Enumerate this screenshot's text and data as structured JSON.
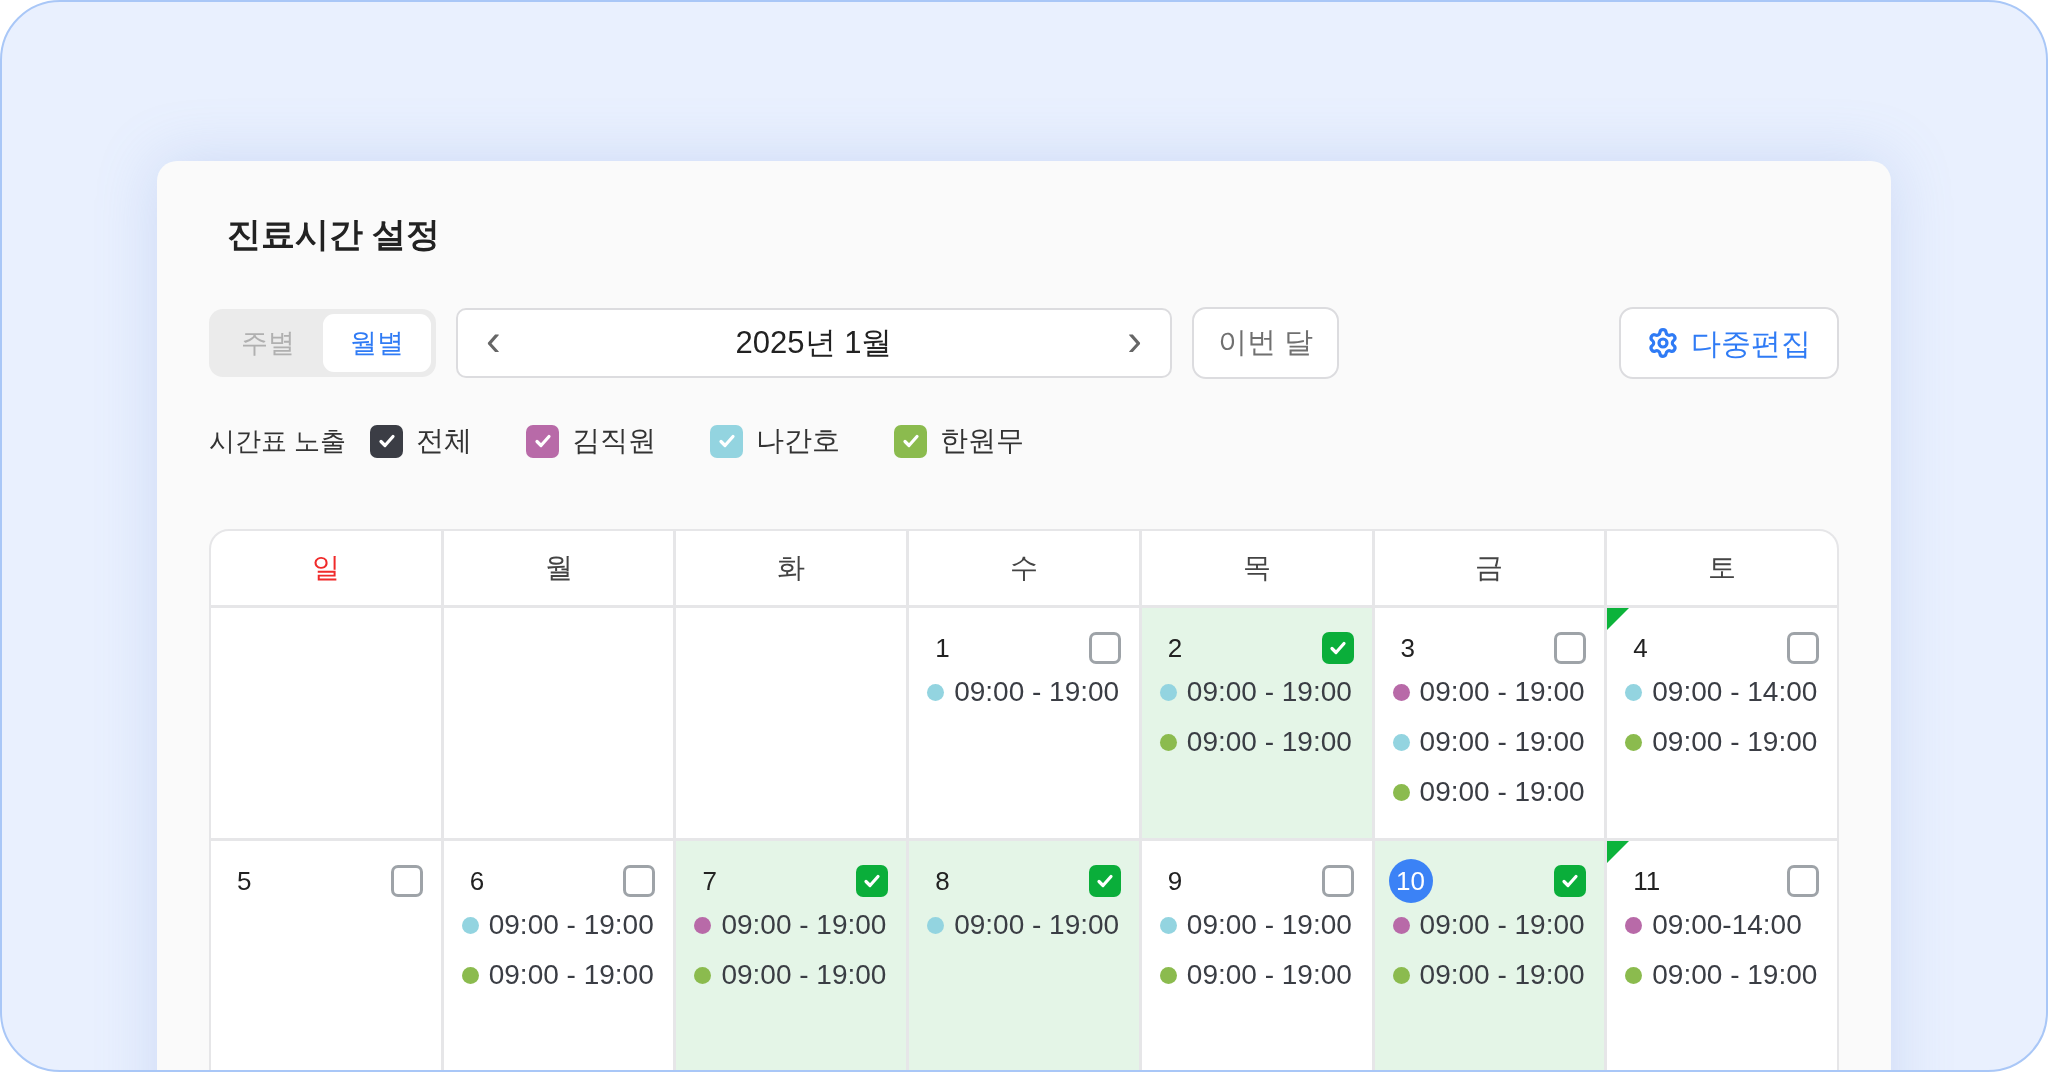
{
  "title": "진료시간 설정",
  "view_toggle": [
    {
      "label": "주별",
      "selected": false
    },
    {
      "label": "월별",
      "selected": true
    }
  ],
  "month_nav": {
    "prev": "‹",
    "label": "2025년 1월",
    "next": "›"
  },
  "today_button": "이번 달",
  "multi_edit_button": "다중편집",
  "legend": {
    "label": "시간표 노출",
    "items": [
      {
        "label": "전체",
        "checked": true,
        "color": "#3b3d45"
      },
      {
        "label": "김직원",
        "checked": true,
        "color": "#b86aa8"
      },
      {
        "label": "나간호",
        "checked": true,
        "color": "#93d4e0"
      },
      {
        "label": "한원무",
        "checked": true,
        "color": "#8bbb4e"
      }
    ]
  },
  "weekdays": [
    {
      "label": "일",
      "holiday": true
    },
    {
      "label": "월",
      "holiday": false
    },
    {
      "label": "화",
      "holiday": false
    },
    {
      "label": "수",
      "holiday": false
    },
    {
      "label": "목",
      "holiday": false
    },
    {
      "label": "금",
      "holiday": false
    },
    {
      "label": "토",
      "holiday": false
    }
  ],
  "weeks": [
    [
      {
        "kind": "blank"
      },
      {
        "kind": "blank"
      },
      {
        "kind": "blank"
      },
      {
        "kind": "day",
        "date": "1",
        "checked": false,
        "today": false,
        "flagged": false,
        "entries": [
          {
            "time": "09:00 - 19:00",
            "color": "#93d4e0"
          }
        ]
      },
      {
        "kind": "day",
        "date": "2",
        "checked": true,
        "today": false,
        "flagged": false,
        "entries": [
          {
            "time": "09:00 - 19:00",
            "color": "#93d4e0"
          },
          {
            "time": "09:00 - 19:00",
            "color": "#8bbb4e"
          }
        ]
      },
      {
        "kind": "day",
        "date": "3",
        "checked": false,
        "today": false,
        "flagged": false,
        "entries": [
          {
            "time": "09:00 - 19:00",
            "color": "#b86aa8"
          },
          {
            "time": "09:00 - 19:00",
            "color": "#93d4e0"
          },
          {
            "time": "09:00 - 19:00",
            "color": "#8bbb4e"
          }
        ]
      },
      {
        "kind": "day",
        "date": "4",
        "checked": false,
        "today": false,
        "flagged": true,
        "entries": [
          {
            "time": "09:00 - 14:00",
            "color": "#93d4e0"
          },
          {
            "time": "09:00 - 19:00",
            "color": "#8bbb4e"
          }
        ]
      }
    ],
    [
      {
        "kind": "day",
        "date": "5",
        "checked": false,
        "today": false,
        "flagged": false
      },
      {
        "kind": "day",
        "date": "6",
        "checked": false,
        "today": false,
        "flagged": false,
        "entries": [
          {
            "time": "09:00 - 19:00",
            "color": "#93d4e0"
          },
          {
            "time": "09:00 - 19:00",
            "color": "#8bbb4e"
          }
        ]
      },
      {
        "kind": "day",
        "date": "7",
        "checked": true,
        "today": false,
        "flagged": false,
        "entries": [
          {
            "time": "09:00 - 19:00",
            "color": "#b86aa8"
          },
          {
            "time": "09:00 - 19:00",
            "color": "#8bbb4e"
          }
        ]
      },
      {
        "kind": "day",
        "date": "8",
        "checked": true,
        "today": false,
        "flagged": false,
        "entries": [
          {
            "time": "09:00 - 19:00",
            "color": "#93d4e0"
          }
        ]
      },
      {
        "kind": "day",
        "date": "9",
        "checked": false,
        "today": false,
        "flagged": false,
        "entries": [
          {
            "time": "09:00 - 19:00",
            "color": "#93d4e0"
          },
          {
            "time": "09:00 - 19:00",
            "color": "#8bbb4e"
          }
        ]
      },
      {
        "kind": "day",
        "date": "10",
        "checked": true,
        "today": true,
        "flagged": false,
        "entries": [
          {
            "time": "09:00 - 19:00",
            "color": "#b86aa8"
          },
          {
            "time": "09:00 - 19:00",
            "color": "#8bbb4e"
          }
        ]
      },
      {
        "kind": "day",
        "date": "11",
        "checked": false,
        "today": false,
        "flagged": true,
        "entries": [
          {
            "time": "09:00-14:00",
            "color": "#b86aa8"
          },
          {
            "time": "09:00 - 19:00",
            "color": "#8bbb4e"
          }
        ]
      }
    ]
  ]
}
